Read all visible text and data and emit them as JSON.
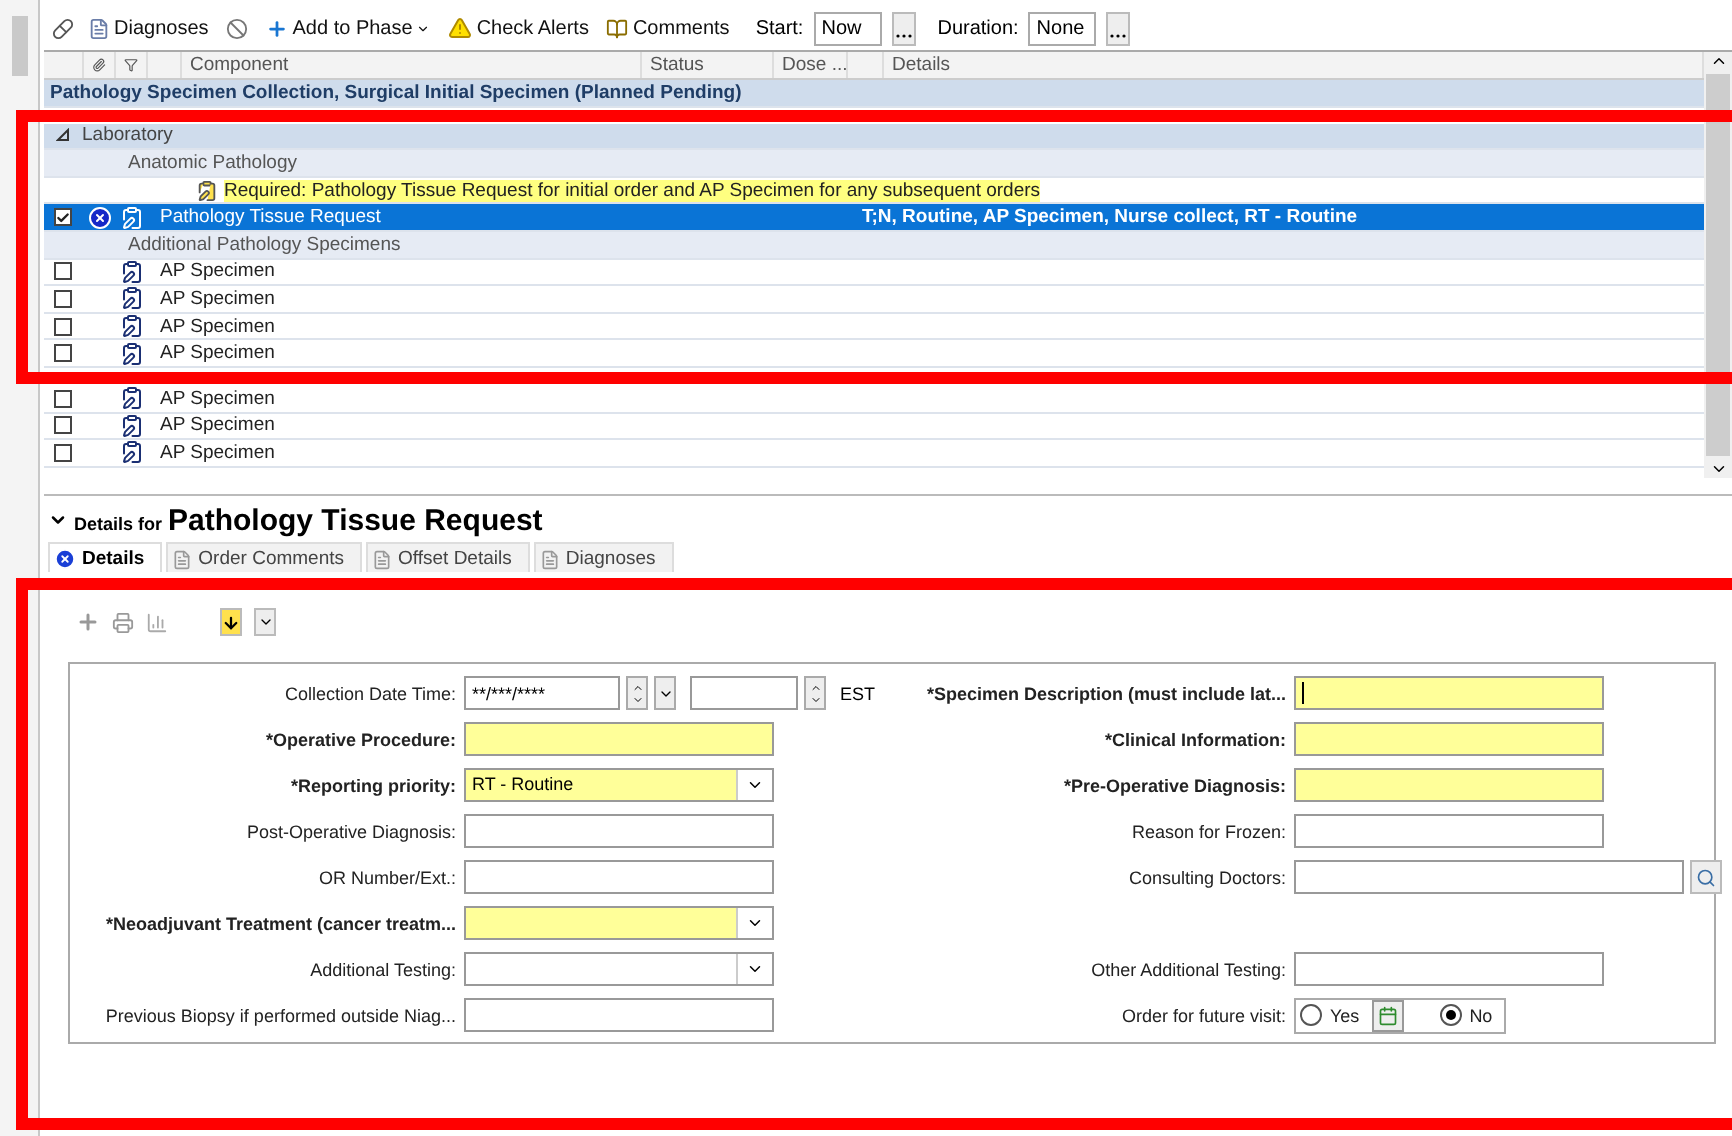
{
  "toolbar": {
    "buttons": [
      {
        "kind": "diagnoses",
        "label": "Diagnoses"
      },
      {
        "kind": "cancel"
      },
      {
        "kind": "add",
        "label": "Add to Phase",
        "dropdown": true
      },
      {
        "kind": "alerts",
        "label": "Check Alerts"
      },
      {
        "kind": "comments",
        "label": "Comments"
      }
    ],
    "start": {
      "label": "Start:",
      "value": "Now"
    },
    "duration": {
      "label": "Duration:",
      "value": "None"
    }
  },
  "grid": {
    "columns": [
      "Component",
      "Status",
      "Dose ...",
      "Details"
    ],
    "phase": "Pathology Specimen Collection, Surgical Initial Specimen (Planned Pending)",
    "highlighted_rows": [
      {
        "kind": "category",
        "label": "Laboratory",
        "expanded": true
      },
      {
        "kind": "subcategory",
        "label": "Anatomic Pathology"
      },
      {
        "kind": "note",
        "label": "Required: Pathology Tissue Request for initial order and AP Specimen for any subsequent orders"
      },
      {
        "kind": "order",
        "label": "Pathology Tissue Request",
        "checked": true,
        "selected": true,
        "details": "T;N, Routine, AP Specimen, Nurse collect, RT - Routine"
      },
      {
        "kind": "subcategory",
        "label": "Additional Pathology Specimens"
      },
      {
        "kind": "order",
        "label": "AP Specimen",
        "checked": false,
        "selected": false
      },
      {
        "kind": "order",
        "label": "AP Specimen",
        "checked": false,
        "selected": false
      },
      {
        "kind": "order",
        "label": "AP Specimen",
        "checked": false,
        "selected": false
      },
      {
        "kind": "order",
        "label": "AP Specimen",
        "checked": false,
        "selected": false
      }
    ],
    "rows": [
      {
        "kind": "order",
        "label": "AP Specimen",
        "checked": false,
        "selected": false
      },
      {
        "kind": "order",
        "label": "AP Specimen",
        "checked": false,
        "selected": false
      },
      {
        "kind": "order",
        "label": "AP Specimen",
        "checked": false,
        "selected": false
      }
    ]
  },
  "details": {
    "prefix": "Details for",
    "title": "Pathology Tissue Request",
    "highlighted": true,
    "tabs": [
      {
        "label": "Details",
        "selected": true
      },
      {
        "label": "Order Comments",
        "selected": false
      },
      {
        "label": "Offset Details",
        "selected": false
      },
      {
        "label": "Diagnoses",
        "selected": false
      }
    ],
    "form": [
      {
        "left": {
          "label": "Collection Date  Time:",
          "kind": "datetime",
          "required": false,
          "value": "**/***/****",
          "zone": "EST"
        },
        "right": {
          "label": "*Specimen Description (must include lat...",
          "kind": "text",
          "required": true,
          "focused": true
        }
      },
      {
        "left": {
          "label": "*Operative Procedure:",
          "kind": "text",
          "required": true
        },
        "right": {
          "label": "*Clinical Information:",
          "kind": "text",
          "required": true
        }
      },
      {
        "left": {
          "label": "*Reporting priority:",
          "kind": "dropdown",
          "required": true,
          "value": "RT - Routine"
        },
        "right": {
          "label": "*Pre-Operative Diagnosis:",
          "kind": "text",
          "required": true
        }
      },
      {
        "left": {
          "label": "Post-Operative Diagnosis:",
          "kind": "text",
          "required": false
        },
        "right": {
          "label": "Reason for Frozen:",
          "kind": "text",
          "required": false
        }
      },
      {
        "left": {
          "label": "OR Number/Ext.:",
          "kind": "text",
          "required": false
        },
        "right": {
          "label": "Consulting Doctors:",
          "kind": "lookup",
          "required": false
        }
      },
      {
        "left": {
          "label": "*Neoadjuvant Treatment (cancer treatm...",
          "kind": "dropdown",
          "required": true
        }
      },
      {
        "left": {
          "label": "Additional Testing:",
          "kind": "dropdown",
          "required": false
        },
        "right": {
          "label": "Other Additional Testing:",
          "kind": "text",
          "required": false
        }
      },
      {
        "left": {
          "label": "Previous Biopsy if performed outside Niag...",
          "kind": "text",
          "required": false
        },
        "right": {
          "label": "Order for future visit:",
          "kind": "radio",
          "required": false,
          "options": [
            {
              "label": "Yes",
              "selected": false
            },
            {
              "label": "No",
              "selected": true
            }
          ]
        }
      }
    ]
  }
}
